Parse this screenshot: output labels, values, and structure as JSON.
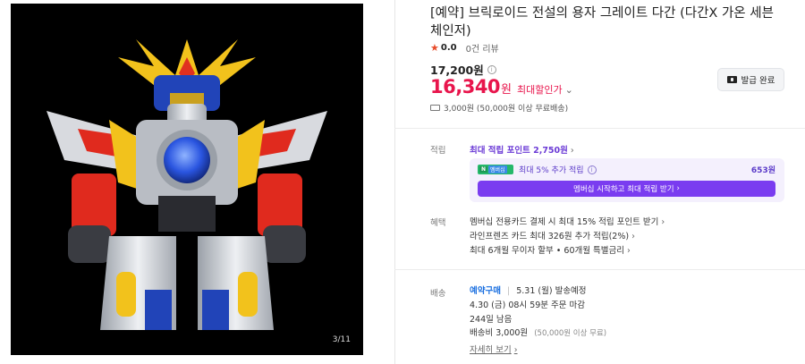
{
  "image": {
    "counter": "3/11"
  },
  "product": {
    "title": "[예약] 브릭로이드 전설의 용자 그레이트 다간 (다간X 가온 세븐 체인저)",
    "rating": "0.0",
    "reviews": "0건 리뷰",
    "original_price": "17,200원",
    "sale_price": "16,340",
    "sale_unit": "원",
    "sale_label": "최대할인가",
    "coupon_button": "발급 완료",
    "shipping": "3,000원 (50,000원 이상 무료배송)"
  },
  "points": {
    "label": "적립",
    "max_points": "최대 적립 포인트 2,750원",
    "member_badge_n": "N",
    "member_badge_text": "멤버십",
    "member_text": "최대 5% 추가 적립",
    "member_point": "653원",
    "member_button": "멤버십 시작하고 최대 적립 받기"
  },
  "benefits": {
    "label": "혜택",
    "items": [
      "멤버십 전용카드 결제 시 최대 15% 적립 포인트 받기",
      "라인프렌즈 카드 최대 326원 추가 적립(2%)",
      "최대 6개월 무이자 할부 • 60개월 특별금리"
    ]
  },
  "delivery": {
    "label": "배송",
    "preorder_tag": "예약구매",
    "ship_date": "5.31 (월) 발송예정",
    "deadline": "4.30 (금) 08시 59분 주문 마감",
    "days_left": "244일 남음",
    "fee": "배송비 3,000원",
    "fee_note": "(50,000원 이상 무료)",
    "details_link": "자세히 보기"
  },
  "colors": {
    "accent_red": "#e8154c",
    "accent_purple": "#7a3cf0",
    "star": "#e84c2b"
  }
}
